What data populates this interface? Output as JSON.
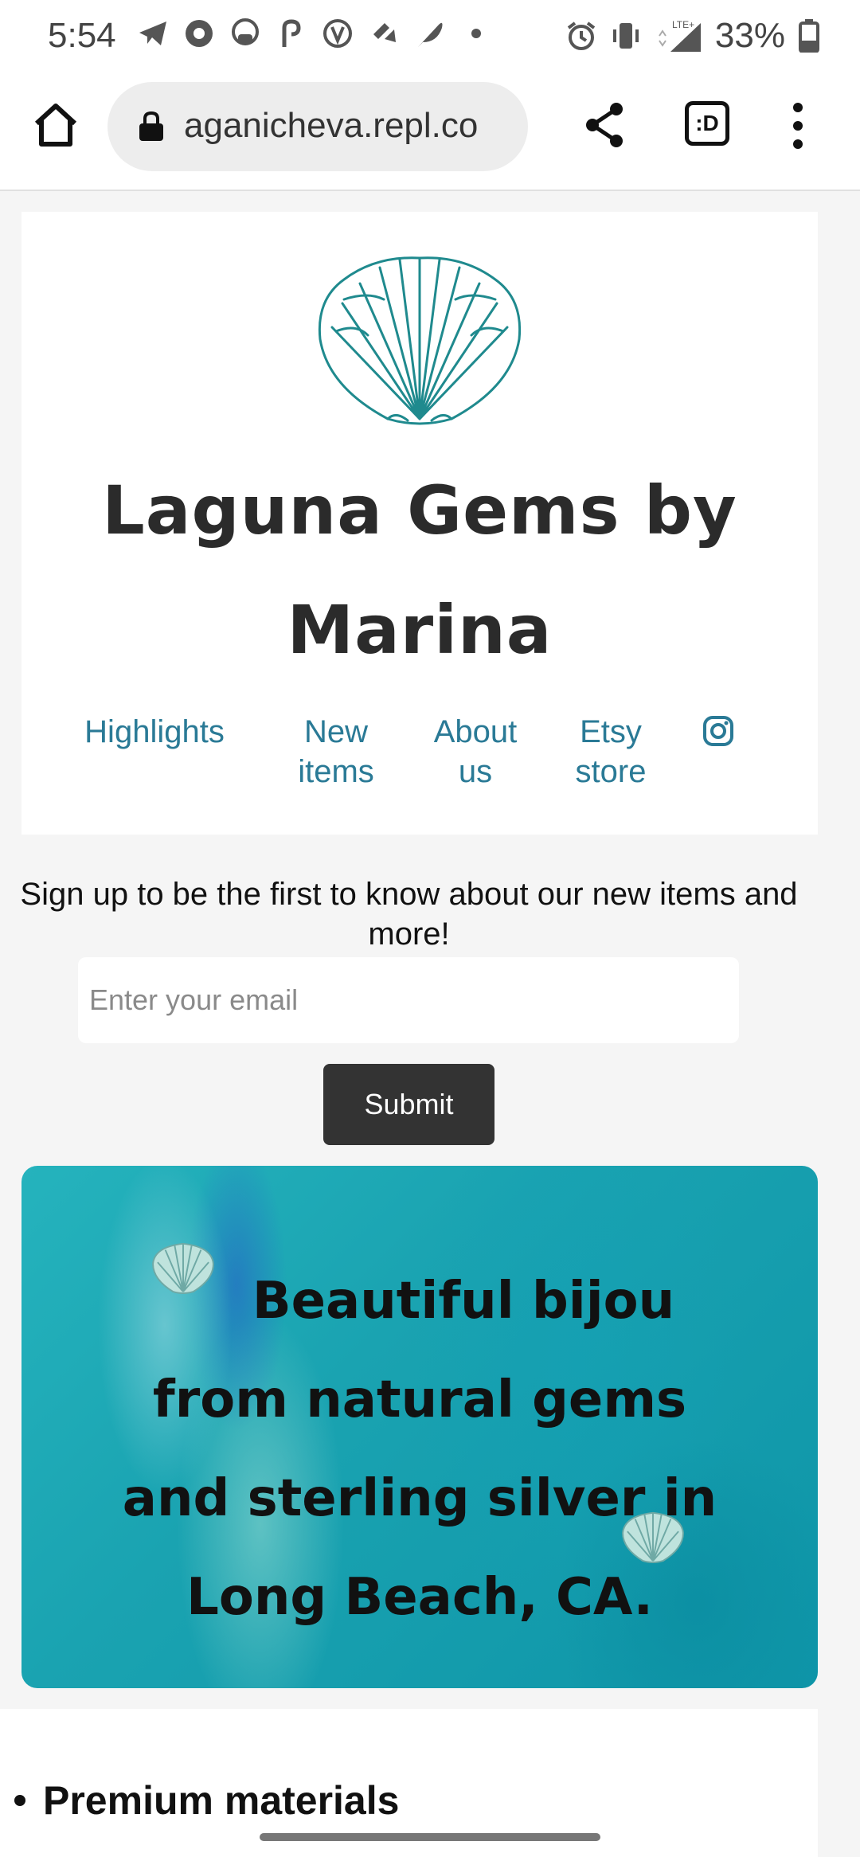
{
  "status_bar": {
    "time": "5:54",
    "battery_percent": "33%",
    "network_label": "LTE+"
  },
  "browser": {
    "url": "aganicheva.repl.co",
    "tabs_label": ":D"
  },
  "header": {
    "title": "Laguna Gems by Marina",
    "nav": [
      {
        "label": "Highlights"
      },
      {
        "label": "New items"
      },
      {
        "label": "About us"
      },
      {
        "label": "Etsy store"
      }
    ]
  },
  "signup": {
    "text": "Sign up to be the first to know about our new items and more!",
    "email_placeholder": "Enter your email",
    "submit_label": "Submit"
  },
  "hero": {
    "text": "Beautiful bijou from natural gems and sterling silver in Long Beach, CA."
  },
  "features": {
    "items": [
      "Premium materials"
    ]
  },
  "colors": {
    "link": "#2a7a96",
    "shell_logo": "#1f8a8e",
    "button_bg": "#333333",
    "hero_teal": "#1aa3b1"
  }
}
